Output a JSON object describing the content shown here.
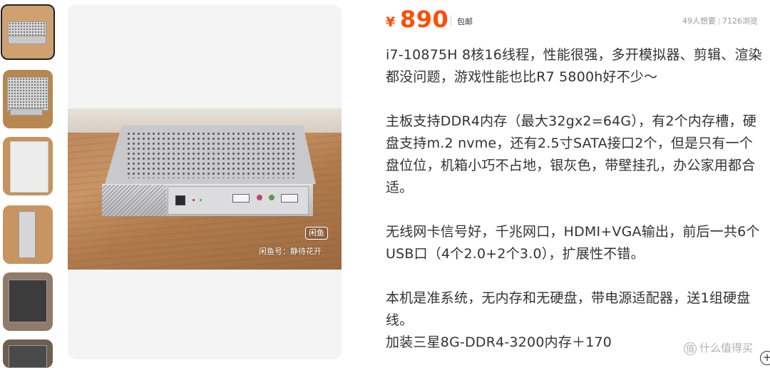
{
  "gallery": {
    "thumbnails": [
      {
        "label": "thumbnail-1",
        "selected": true
      },
      {
        "label": "thumbnail-2",
        "selected": false
      },
      {
        "label": "thumbnail-3",
        "selected": false
      },
      {
        "label": "thumbnail-4",
        "selected": false
      },
      {
        "label": "thumbnail-5",
        "selected": false
      },
      {
        "label": "thumbnail-6",
        "selected": false
      }
    ],
    "main_image": {
      "logo_badge": "闲鱼",
      "watermark": "闲鱼号：静待花开"
    }
  },
  "price": {
    "currency": "¥",
    "amount": "890",
    "shipping": "包邮",
    "color": "#ff4d00"
  },
  "stats": {
    "wants": "49人想要",
    "views": "7126浏览"
  },
  "description": [
    "i7-10875H 8核16线程，性能很强，多开模拟器、剪辑、渲染都没问题，游戏性能也比R7 5800h好不少～",
    "",
    "主板支持DDR4内存（最大32gx2=64G），有2个内存槽，硬盘支持m.2 nvme，还有2.5寸SATA接口2个，但是只有一个盘位位，机箱小巧不占地，银灰色，带壁挂孔，办公家用都合适。",
    "",
    "无线网卡信号好，千兆网口，HDMI+VGA输出，前后一共6个USB口（4个2.0+2个3.0），扩展性不错。",
    "",
    "本机是准系统，无内存和无硬盘，带电源适配器，送1组硬盘线。",
    "加装三星8G-DDR4-3200内存＋170"
  ],
  "site_watermark": {
    "icon": "值",
    "text": "什么值得买"
  },
  "plus_button": "+"
}
